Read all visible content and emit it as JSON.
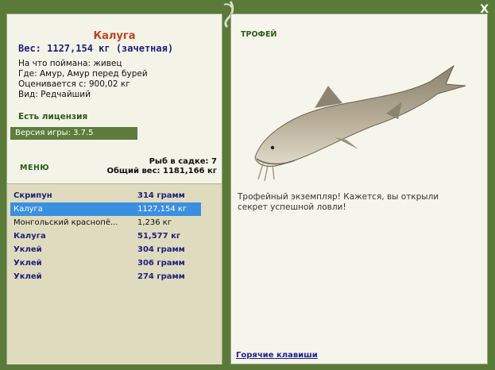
{
  "window": {
    "close_label": "X"
  },
  "fish_info": {
    "title": "Калуга",
    "weight_line": "Вес: 1127,154 кг (зачетная)",
    "bait_line": "На что поймана: живец",
    "location_line": "Где: Амур, Амур перед бурей",
    "value_line": "Оценивается с: 900,02 кг",
    "type_line": "Вид: Редчайший"
  },
  "license": {
    "label": "Есть лицензия"
  },
  "version": {
    "label": "Версия игры: 3.7.5"
  },
  "menu": {
    "label": "МЕНЮ"
  },
  "keepnet": {
    "count_line": "Рыб в садке: 7",
    "total_line": "Общий вес: 1181,166 кг"
  },
  "fish_list": [
    {
      "name": "Скрипун",
      "weight": "314 грамм",
      "style": "bold"
    },
    {
      "name": "Калуга",
      "weight": "1127,154 кг",
      "style": "sel"
    },
    {
      "name": "Монгольский краснопё...",
      "weight": "1,236 кг",
      "style": "plain"
    },
    {
      "name": "Калуга",
      "weight": "51,577 кг",
      "style": "bold"
    },
    {
      "name": "Уклей",
      "weight": "304 грамм",
      "style": "bold"
    },
    {
      "name": "Уклей",
      "weight": "306 грамм",
      "style": "bold"
    },
    {
      "name": "Уклей",
      "weight": "274 грамм",
      "style": "bold"
    }
  ],
  "trophy": {
    "heading": "ТРОФЕЙ",
    "description": "Трофейный экземпляр! Кажется, вы открыли секрет успешной ловли!"
  },
  "hotkeys": {
    "label": "Горячие клавиши"
  },
  "colors": {
    "frame": "#5a7a39",
    "accent_blue": "#1f1f7a",
    "selection": "#3a8fe0",
    "title": "#c0431c"
  }
}
